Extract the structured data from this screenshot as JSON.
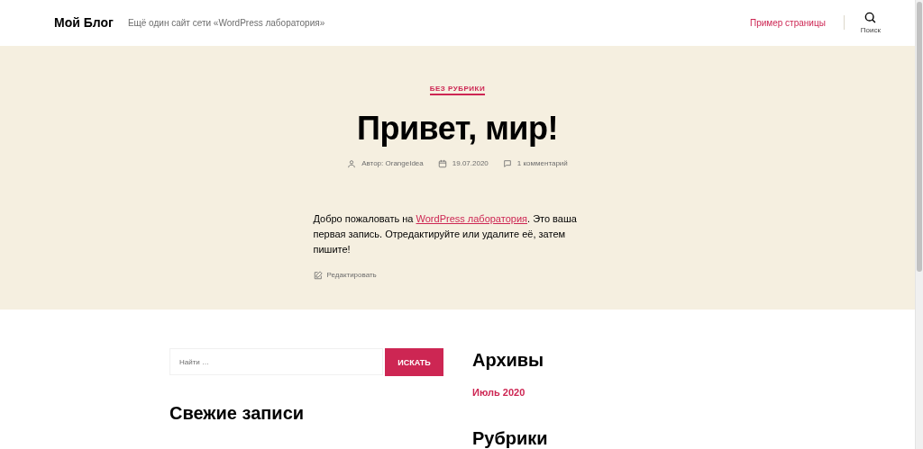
{
  "header": {
    "site_title": "Мой Блог",
    "tagline": "Ещё один сайт сети «WordPress лаборатория»",
    "nav": [
      {
        "label": "Пример страницы"
      }
    ],
    "search_label": "Поиск"
  },
  "post": {
    "category": "БЕЗ РУБРИКИ",
    "title": "Привет, мир!",
    "author": "Автор: OrangeIdea",
    "date": "19.07.2020",
    "comments": "1 комментарий",
    "body_before": "Добро пожаловать на ",
    "body_link": "WordPress лаборатория",
    "body_after": ". Это ваша первая запись. Отредактируйте или удалите её, затем пишите!",
    "edit": "Редактировать"
  },
  "widgets": {
    "search": {
      "placeholder": "Найти …",
      "button": "ИСКАТЬ"
    },
    "recent_title": "Свежие записи",
    "archives_title": "Архивы",
    "archives": [
      "Июль 2020"
    ],
    "categories_title": "Рубрики"
  }
}
